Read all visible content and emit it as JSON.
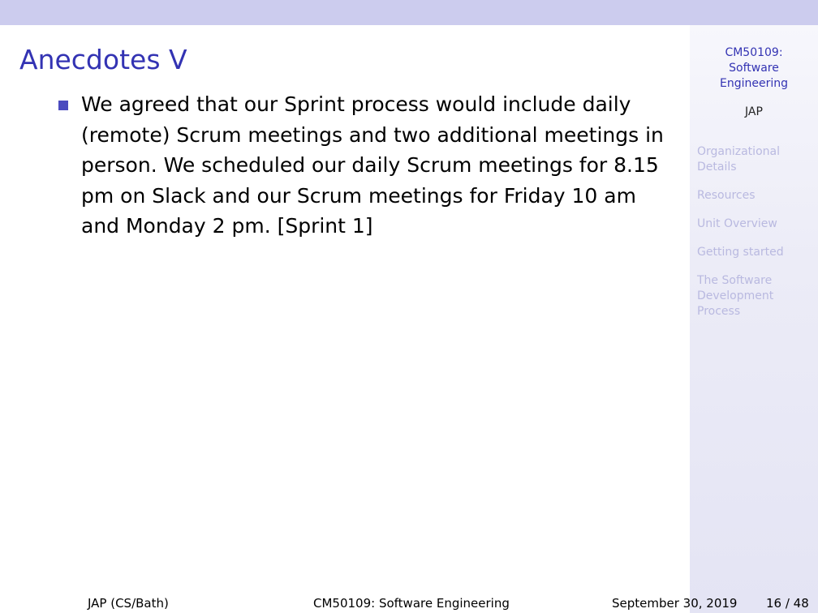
{
  "sidebar": {
    "title_lines": [
      "CM50109:",
      "Software",
      "Engineering"
    ],
    "author": "JAP",
    "nav": [
      "Organizational Details",
      "Resources",
      "Unit Overview",
      "Getting started",
      "The Software Development Process"
    ]
  },
  "slide": {
    "title": "Anecdotes V",
    "bullets": [
      "We agreed that our Sprint process would include daily (remote) Scrum meetings and two additional meetings in person. We scheduled our daily Scrum meetings for 8.15 pm on Slack and our Scrum meetings for Friday 10 am and Monday 2 pm. [Sprint 1]"
    ]
  },
  "footer": {
    "author": "JAP  (CS/Bath)",
    "title": "CM50109: Software Engineering",
    "date": "September 30, 2019",
    "page": "16 / 48"
  },
  "colors": {
    "accent": "#3333b3",
    "topbar": "#ccccee",
    "nav_inactive": "#b9b9e0",
    "bullet": "#4b4bbf"
  }
}
